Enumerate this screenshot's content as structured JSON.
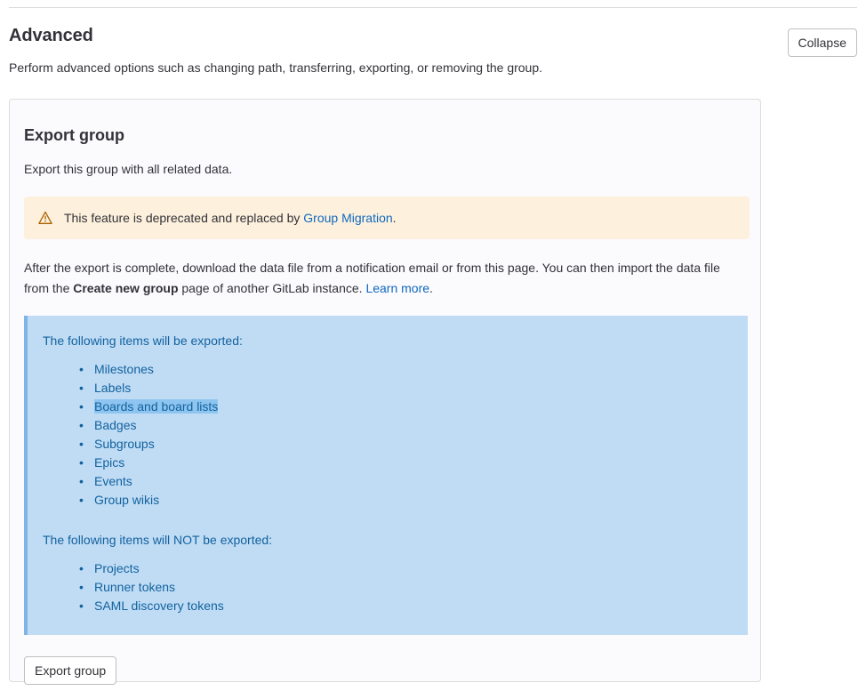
{
  "section": {
    "title": "Advanced",
    "description": "Perform advanced options such as changing path, transferring, exporting, or removing the group.",
    "collapse_label": "Collapse"
  },
  "export_card": {
    "title": "Export group",
    "subtitle": "Export this group with all related data.",
    "alert": {
      "icon": "warning-triangle-icon",
      "text_before": "This feature is deprecated and replaced by ",
      "link_label": "Group Migration",
      "text_after": ".",
      "background": "#fdf1dd",
      "icon_color": "#ab6100"
    },
    "paragraph": {
      "part1": "After the export is complete, download the data file from a notification email or from this page. You can then import the data file from the ",
      "strong": "Create new group",
      "part2": " page of another GitLab instance. ",
      "link_label": "Learn more",
      "part3": "."
    },
    "info": {
      "background": "#c0dcf5",
      "accent": "#7fb5e6",
      "text_color": "#12629e",
      "selection_color": "#8ec5f0",
      "exported_heading": "The following items will be exported:",
      "exported_items": [
        {
          "label": "Milestones",
          "selected": false
        },
        {
          "label": "Labels",
          "selected": false
        },
        {
          "label": "Boards and board lists",
          "selected": true
        },
        {
          "label": "Badges",
          "selected": false
        },
        {
          "label": "Subgroups",
          "selected": false
        },
        {
          "label": "Epics",
          "selected": false
        },
        {
          "label": "Events",
          "selected": false
        },
        {
          "label": "Group wikis",
          "selected": false
        }
      ],
      "not_exported_heading": "The following items will NOT be exported:",
      "not_exported_items": [
        {
          "label": "Projects",
          "selected": false
        },
        {
          "label": "Runner tokens",
          "selected": false
        },
        {
          "label": "SAML discovery tokens",
          "selected": false
        }
      ]
    },
    "export_button_label": "Export group"
  },
  "theme": {
    "link_color": "#1068bf",
    "text_color": "#333238",
    "card_background": "#fbfafd",
    "card_border": "#dcdcde"
  }
}
